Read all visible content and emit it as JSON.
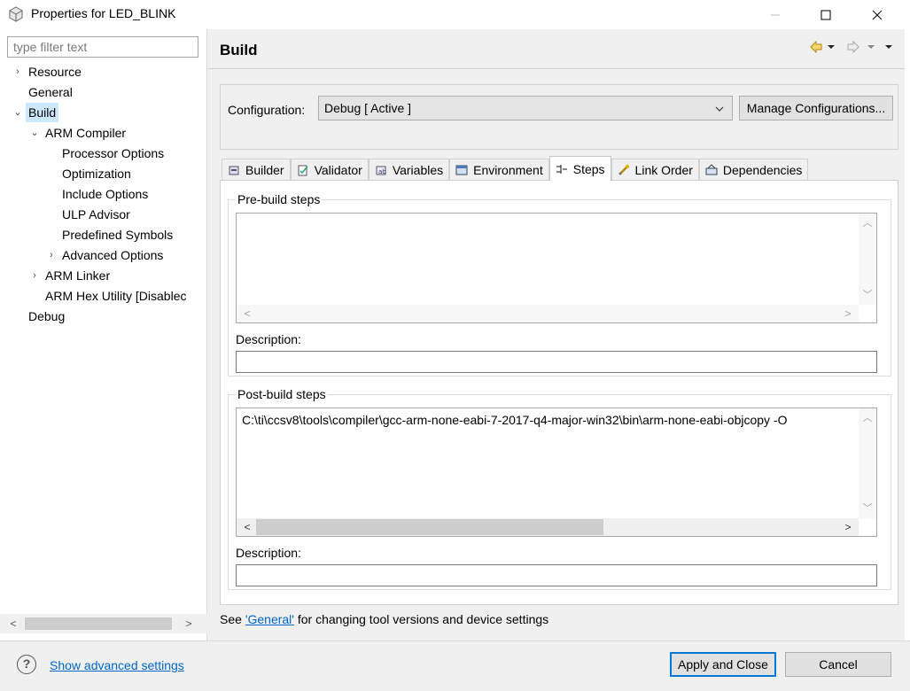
{
  "window": {
    "title": "Properties for LED_BLINK",
    "minimize_glyph": "—",
    "maximize_glyph": "☐",
    "close_glyph": "✕"
  },
  "sidebar": {
    "filter_placeholder": "type filter text",
    "items": [
      {
        "label": "Resource",
        "arrow": "›",
        "level": 0
      },
      {
        "label": "General",
        "arrow": "",
        "level": 0
      },
      {
        "label": "Build",
        "arrow": "⌄",
        "level": 0,
        "selected": true
      },
      {
        "label": "ARM Compiler",
        "arrow": "⌄",
        "level": 1
      },
      {
        "label": "Processor Options",
        "arrow": "",
        "level": 2
      },
      {
        "label": "Optimization",
        "arrow": "",
        "level": 2
      },
      {
        "label": "Include Options",
        "arrow": "",
        "level": 2
      },
      {
        "label": "ULP Advisor",
        "arrow": "",
        "level": 2
      },
      {
        "label": "Predefined Symbols",
        "arrow": "",
        "level": 2
      },
      {
        "label": "Advanced Options",
        "arrow": "›",
        "level": 2
      },
      {
        "label": "ARM Linker",
        "arrow": "›",
        "level": 1
      },
      {
        "label": "ARM Hex Utility  [Disablec",
        "arrow": "",
        "level": 1
      },
      {
        "label": "Debug",
        "arrow": "",
        "level": 0
      }
    ]
  },
  "main": {
    "title": "Build",
    "configuration_label": "Configuration:",
    "configuration_value": "Debug  [ Active ]",
    "manage_button": "Manage Configurations...",
    "tabs": [
      {
        "label": "Builder",
        "icon": "builder-icon"
      },
      {
        "label": "Validator",
        "icon": "validator-icon"
      },
      {
        "label": "Variables",
        "icon": "variables-icon"
      },
      {
        "label": "Environment",
        "icon": "environment-icon"
      },
      {
        "label": "Steps",
        "icon": "steps-icon",
        "active": true
      },
      {
        "label": "Link Order",
        "icon": "link-order-icon"
      },
      {
        "label": "Dependencies",
        "icon": "dependencies-icon"
      }
    ],
    "prebuild": {
      "group_label": "Pre-build steps",
      "value": "",
      "description_label": "Description:",
      "description_value": ""
    },
    "postbuild": {
      "group_label": "Post-build steps",
      "value": "C:\\ti\\ccsv8\\tools\\compiler\\gcc-arm-none-eabi-7-2017-q4-major-win32\\bin\\arm-none-eabi-objcopy -O",
      "description_label": "Description:",
      "description_value": ""
    },
    "footer_prefix": "See ",
    "footer_link": "'General'",
    "footer_suffix": " for changing tool versions and device settings"
  },
  "bottom": {
    "help_glyph": "?",
    "advanced_link": "Show advanced settings",
    "apply_button": "Apply and Close",
    "cancel_button": "Cancel"
  }
}
